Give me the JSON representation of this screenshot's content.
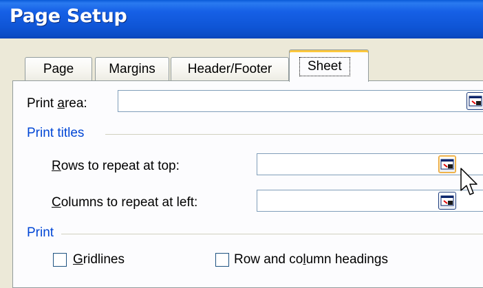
{
  "window": {
    "title": "Page Setup"
  },
  "tabs": [
    {
      "label": "Page"
    },
    {
      "label": "Margins"
    },
    {
      "label": "Header/Footer"
    },
    {
      "label": "Sheet",
      "active": true
    }
  ],
  "print_area": {
    "label_pre": "Print ",
    "label_key": "a",
    "label_post": "rea:",
    "value": ""
  },
  "print_titles": {
    "heading": "Print titles",
    "rows": {
      "label_key": "R",
      "label_post": "ows to repeat at top:",
      "value": ""
    },
    "columns": {
      "label_key": "C",
      "label_post": "olumns to repeat at left:",
      "value": ""
    }
  },
  "print_section": {
    "heading": "Print",
    "gridlines": {
      "label_key": "G",
      "label_post": "ridlines",
      "checked": false
    },
    "row_col_headings": {
      "label_pre": "Row and co",
      "label_key": "l",
      "label_post": "umn headings",
      "checked": false
    }
  },
  "icons": {
    "collapse_dialog": "range-select-icon",
    "cursor": "mouse-pointer-icon"
  },
  "colors": {
    "titlebar": "#0b55d9",
    "section_heading": "#0046d5",
    "active_tab_accent": "#ffc83c"
  }
}
